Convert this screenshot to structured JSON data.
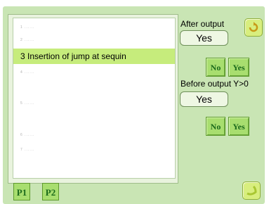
{
  "list": {
    "items": [
      {
        "label": "1 ......",
        "state": "dim"
      },
      {
        "label": "2 ......",
        "state": "dim"
      },
      {
        "label": "3 Insertion of jump at sequin",
        "state": "selected"
      },
      {
        "label": "4 ......",
        "state": "dim"
      },
      {
        "label": "5 ......",
        "state": "dim"
      },
      {
        "label": "6 ......",
        "state": "dim"
      },
      {
        "label": "7 ......",
        "state": "dim"
      }
    ]
  },
  "settings": {
    "after_output": {
      "label": "After output",
      "value": "Yes",
      "no_label": "No",
      "yes_label": "Yes"
    },
    "before_output": {
      "label": "Before output Y>0",
      "value": "Yes",
      "no_label": "No",
      "yes_label": "Yes"
    }
  },
  "pages": {
    "p1_label": "P1",
    "p2_label": "P2"
  },
  "icons": {
    "top_right": "confirm-icon",
    "bottom_right": "back-icon"
  },
  "colors": {
    "panel": "#c9e5b4",
    "selected_row": "#c6ec7c",
    "button": "#a8de6f",
    "button_text": "#1b6a1b"
  }
}
